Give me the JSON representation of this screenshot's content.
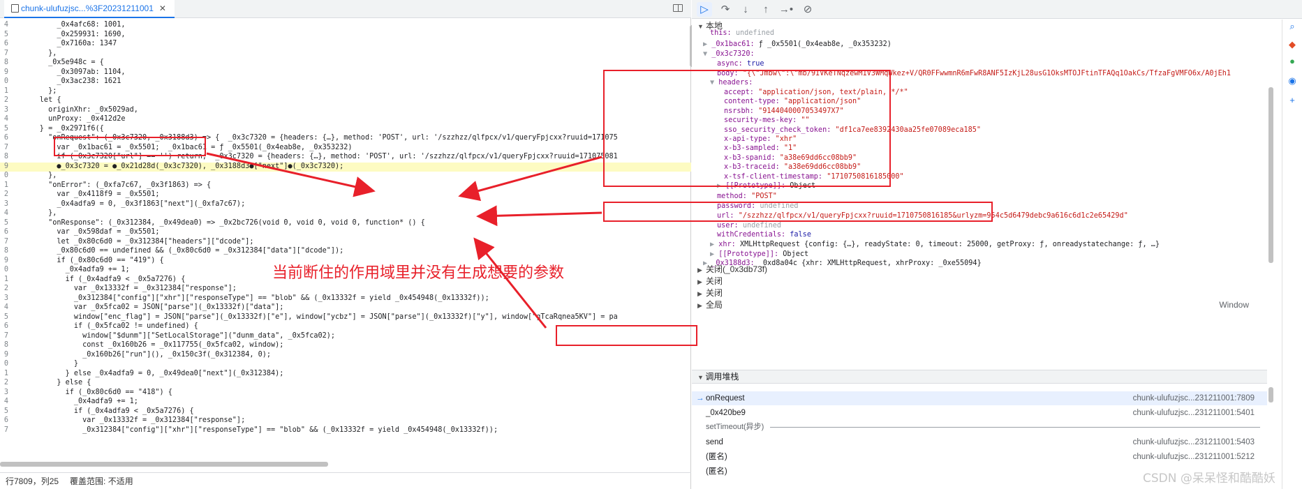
{
  "editor": {
    "tab_name": "chunk-ulufuzjsc...%3F20231211001",
    "status_position": "行7809，列25",
    "status_coverage": "覆盖范围: 不适用",
    "lines": [
      {
        "num": "4",
        "text": "          _0x4afc68: 1001,"
      },
      {
        "num": "5",
        "text": "          _0x259931: 1690,"
      },
      {
        "num": "6",
        "text": "          _0x7160a: 1347"
      },
      {
        "num": "7",
        "text": "        },"
      },
      {
        "num": "8",
        "text": "        _0x5e948c = {"
      },
      {
        "num": "9",
        "text": "          _0x3097ab: 1104,"
      },
      {
        "num": "0",
        "text": "          _0x3ac238: 1621"
      },
      {
        "num": "1",
        "text": "        };"
      },
      {
        "num": "2",
        "text": "      let {"
      },
      {
        "num": "3",
        "text": "        originXhr: _0x5029ad,"
      },
      {
        "num": "4",
        "text": "        unProxy: _0x412d2e"
      },
      {
        "num": "5",
        "text": "      } = _0x2971f6({"
      },
      {
        "num": "6",
        "text": "        \"onRequest\": (_0x3c7320, _0x3188d3) => {  _0x3c7320 = {headers: {…}, method: 'POST', url: '/szzhzz/qlfpcx/v1/queryFpjcxx?ruuid=171075"
      },
      {
        "num": "7",
        "text": "          var _0x1bac61 = _0x5501;  _0x1bac61 = ƒ _0x5501(_0x4eab8e, _0x353232)"
      },
      {
        "num": "8",
        "text": "          if (_0x3c7320[\"url\"] == '') return;  _0x3c7320 = {headers: {…}, method: 'POST', url: '/szzhzz/qlfpcx/v1/queryFpjcxx?ruuid=171075081"
      },
      {
        "num": "9",
        "text": "          ●_0x3c7320 = ●_0x21d28d(_0x3c7320), _0x3188d3●[\"next\"]●(_0x3c7320);"
      },
      {
        "num": "0",
        "text": "        },"
      },
      {
        "num": "1",
        "text": "        \"onError\": (_0xfa7c67, _0x3f1863) => {"
      },
      {
        "num": "2",
        "text": "          var _0x4118f9 = _0x5501;"
      },
      {
        "num": "3",
        "text": "          _0x4adfa9 = 0, _0x3f1863[\"next\"](_0xfa7c67);"
      },
      {
        "num": "4",
        "text": "        },"
      },
      {
        "num": "5",
        "text": "        \"onResponse\": (_0x312384, _0x49dea0) => _0x2bc726(void 0, void 0, void 0, function* () {"
      },
      {
        "num": "6",
        "text": "          var _0x598daf = _0x5501;"
      },
      {
        "num": "7",
        "text": "          let _0x80c6d0 = _0x312384[\"headers\"][\"dcode\"];"
      },
      {
        "num": "8",
        "text": "          _0x80c6d0 == undefined && (_0x80c6d0 = _0x312384[\"data\"][\"dcode\"]);"
      },
      {
        "num": "9",
        "text": "          if (_0x80c6d0 == \"419\") {"
      },
      {
        "num": "0",
        "text": "            _0x4adfa9 += 1;"
      },
      {
        "num": "1",
        "text": "            if (_0x4adfa9 < _0x5a7276) {"
      },
      {
        "num": "2",
        "text": "              var _0x13332f = _0x312384[\"response\"];"
      },
      {
        "num": "3",
        "text": "              _0x312384[\"config\"][\"xhr\"][\"responseType\"] == \"blob\" && (_0x13332f = yield _0x454948(_0x13332f));"
      },
      {
        "num": "4",
        "text": "              var _0x5fca02 = JSON[\"parse\"](_0x13332f)[\"data\"];"
      },
      {
        "num": "5",
        "text": "              window[\"enc_flag\"] = JSON[\"parse\"](_0x13332f)[\"e\"], window[\"ycbz\"] = JSON[\"parse\"](_0x13332f)[\"y\"], window[\"gTcaRqnea5KV\"] = pa"
      },
      {
        "num": "6",
        "text": "              if (_0x5fca02 != undefined) {"
      },
      {
        "num": "7",
        "text": "                window[\"$dunm\"][\"SetLocalStorage\"](\"dunm_data\", _0x5fca02);"
      },
      {
        "num": "8",
        "text": "                const _0x160b26 = _0x117755(_0x5fca02, window);"
      },
      {
        "num": "9",
        "text": "                _0x160b26[\"run\"](), _0x150c3f(_0x312384, 0);"
      },
      {
        "num": "0",
        "text": "              }"
      },
      {
        "num": "1",
        "text": "            } else _0x4adfa9 = 0, _0x49dea0[\"next\"](_0x312384);"
      },
      {
        "num": "2",
        "text": "          } else {"
      },
      {
        "num": "3",
        "text": "            if (_0x80c6d0 == \"418\") {"
      },
      {
        "num": "4",
        "text": "              _0x4adfa9 += 1;"
      },
      {
        "num": "5",
        "text": "              if (_0x4adfa9 < _0x5a7276) {"
      },
      {
        "num": "6",
        "text": "                var _0x13332f = _0x312384[\"response\"];"
      },
      {
        "num": "7",
        "text": "                _0x312384[\"config\"][\"xhr\"][\"responseType\"] == \"blob\" && (_0x13332f = yield _0x454948(_0x13332f));"
      }
    ]
  },
  "scope": {
    "local_label": "本地",
    "this_key": "this:",
    "this_val": "undefined",
    "bac_key": "_0x1bac61:",
    "bac_val": "ƒ _0x5501(_0x4eab8e, _0x353232)",
    "obj_key": "_0x3c7320:",
    "async_key": "async:",
    "async_val": "true",
    "body_key": "body:",
    "body_val": "\"{\\\"Jmbw\\\":\\\"mb/9IVKeTNqzewM1V3WMqWkez+V/QR0FFwwmnR6mFwR8ANF5IzKjL28usG1OksMTOJFtinTFAQq1OakCs/TfzaFgVMFO6x/A0jEh1",
    "headers_key": "headers:",
    "headers": [
      {
        "k": "accept:",
        "v": "\"application/json, text/plain, */*\""
      },
      {
        "k": "content-type:",
        "v": "\"application/json\""
      },
      {
        "k": "nsrsbh:",
        "v": "\"9144040007053497X7\""
      },
      {
        "k": "security-mes-key:",
        "v": "\"\""
      },
      {
        "k": "sso_security_check_token:",
        "v": "\"df1ca7ee8392430aa25fe07089eca185\""
      },
      {
        "k": "x-api-type:",
        "v": "\"xhr\""
      },
      {
        "k": "x-b3-sampled:",
        "v": "\"1\""
      },
      {
        "k": "x-b3-spanid:",
        "v": "\"a38e69dd6cc08bb9\""
      },
      {
        "k": "x-b3-traceid:",
        "v": "\"a38e69dd6cc08bb9\""
      },
      {
        "k": "x-tsf-client-timestamp:",
        "v": "\"1710750816185000\""
      }
    ],
    "proto_key": "[[Prototype]]:",
    "proto_val": "Object",
    "method_key": "method:",
    "method_val": "\"POST\"",
    "password_key": "password:",
    "password_val": "undefined",
    "url_key": "url:",
    "url_val": "\"/szzhzz/qlfpcx/v1/queryFpjcxx?ruuid=1710750816185&urlyzm=954c5d6479debc9a616c6d1c2e65429d\"",
    "user_key": "user:",
    "user_val": "undefined",
    "wc_key": "withCredentials:",
    "wc_val": "false",
    "xhr_key": "xhr:",
    "xhr_val": "XMLHttpRequest {config: {…}, readyState: 0, timeout: 25000, getProxy: ƒ, onreadystatechange: ƒ, …}",
    "proto2_key": "[[Prototype]]:",
    "proto2_val": "Object",
    "d3_key": "_0x3188d3:",
    "d3_val": "_0xd8a04c {xhr: XMLHttpRequest, xhrProxy: _0xe55094}",
    "closure1": "关闭(_0x3db73f)",
    "closure2": "关闭",
    "closure3": "关闭",
    "global": "全局",
    "global_val": "Window"
  },
  "callstack": {
    "label": "调用堆栈",
    "frames": [
      {
        "fn": "onRequest",
        "loc": "chunk-ulufuzjsc...231211001:7809"
      },
      {
        "fn": "_0x420be9",
        "loc": "chunk-ulufuzjsc...231211001:5401"
      }
    ],
    "async_label": "setTimeout(异步)",
    "frames2": [
      {
        "fn": "send",
        "loc": "chunk-ulufuzjsc...231211001:5403"
      },
      {
        "fn": "(匿名)",
        "loc": "chunk-ulufuzjsc...231211001:5212"
      },
      {
        "fn": "(匿名)",
        "loc": ""
      }
    ]
  },
  "annotation": "当前断住的作用域里并没有生成想要的参数",
  "watermark": "CSDN @呆呆怪和酷酷妖",
  "accent": "#1a73e8",
  "annotation_color": "#e8202a"
}
